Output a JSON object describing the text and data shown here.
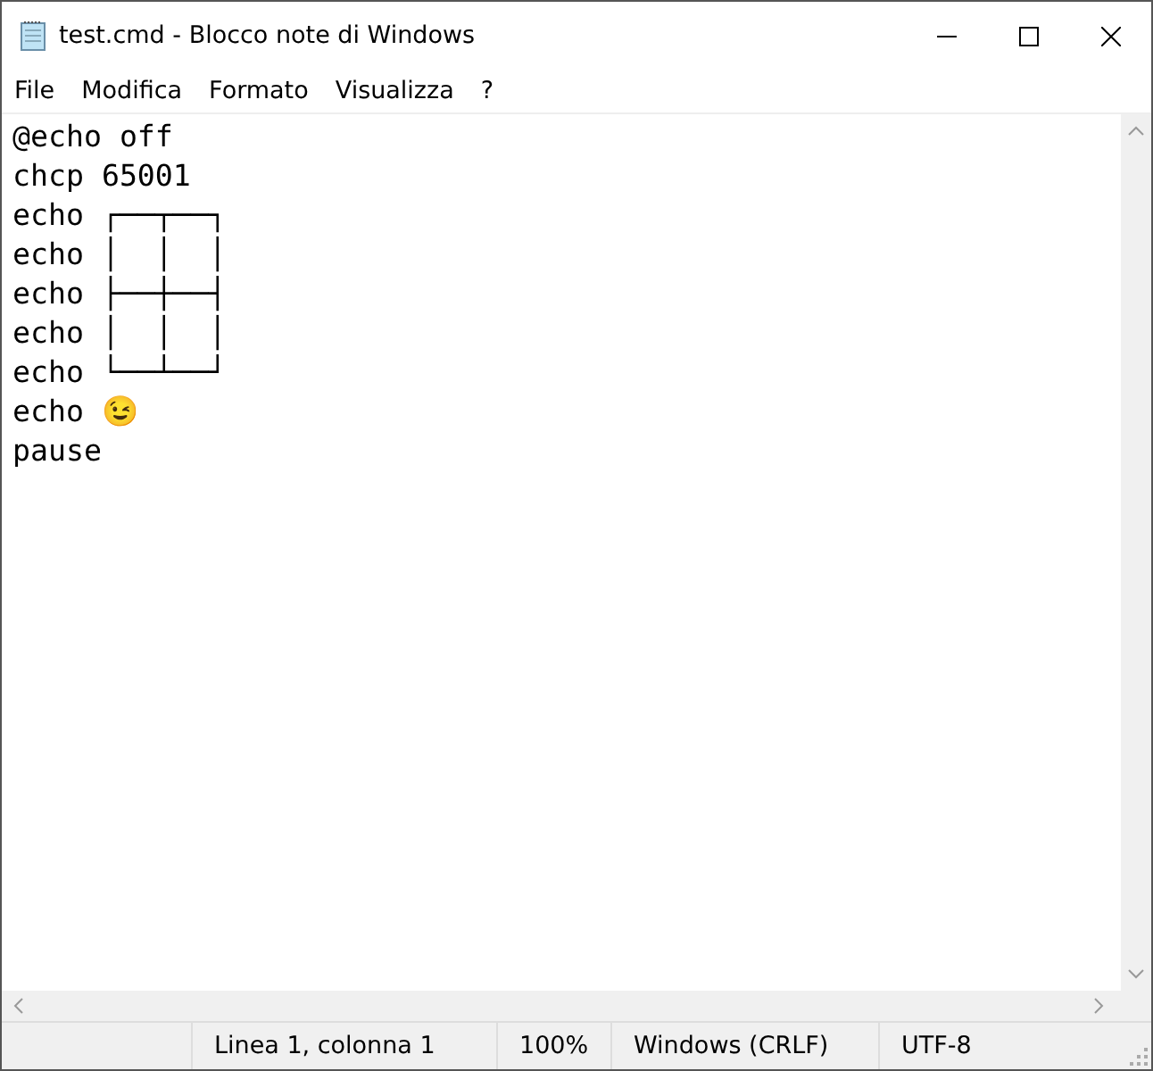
{
  "window": {
    "title": "test.cmd - Blocco note di Windows"
  },
  "menu": [
    {
      "label": "File"
    },
    {
      "label": "Modifica"
    },
    {
      "label": "Formato"
    },
    {
      "label": "Visualizza"
    },
    {
      "label": "?"
    }
  ],
  "editor": {
    "lines": [
      "@echo off",
      "chcp 65001",
      "echo ┌──┬──┐",
      "echo │  │  │",
      "echo ├──┼──┤",
      "echo │  │  │",
      "echo └──┴──┘",
      "echo 😉",
      "pause"
    ]
  },
  "status_bar": [
    "Linea 1, colonna 1",
    "100%",
    "Windows (CRLF)",
    "UTF-8"
  ]
}
